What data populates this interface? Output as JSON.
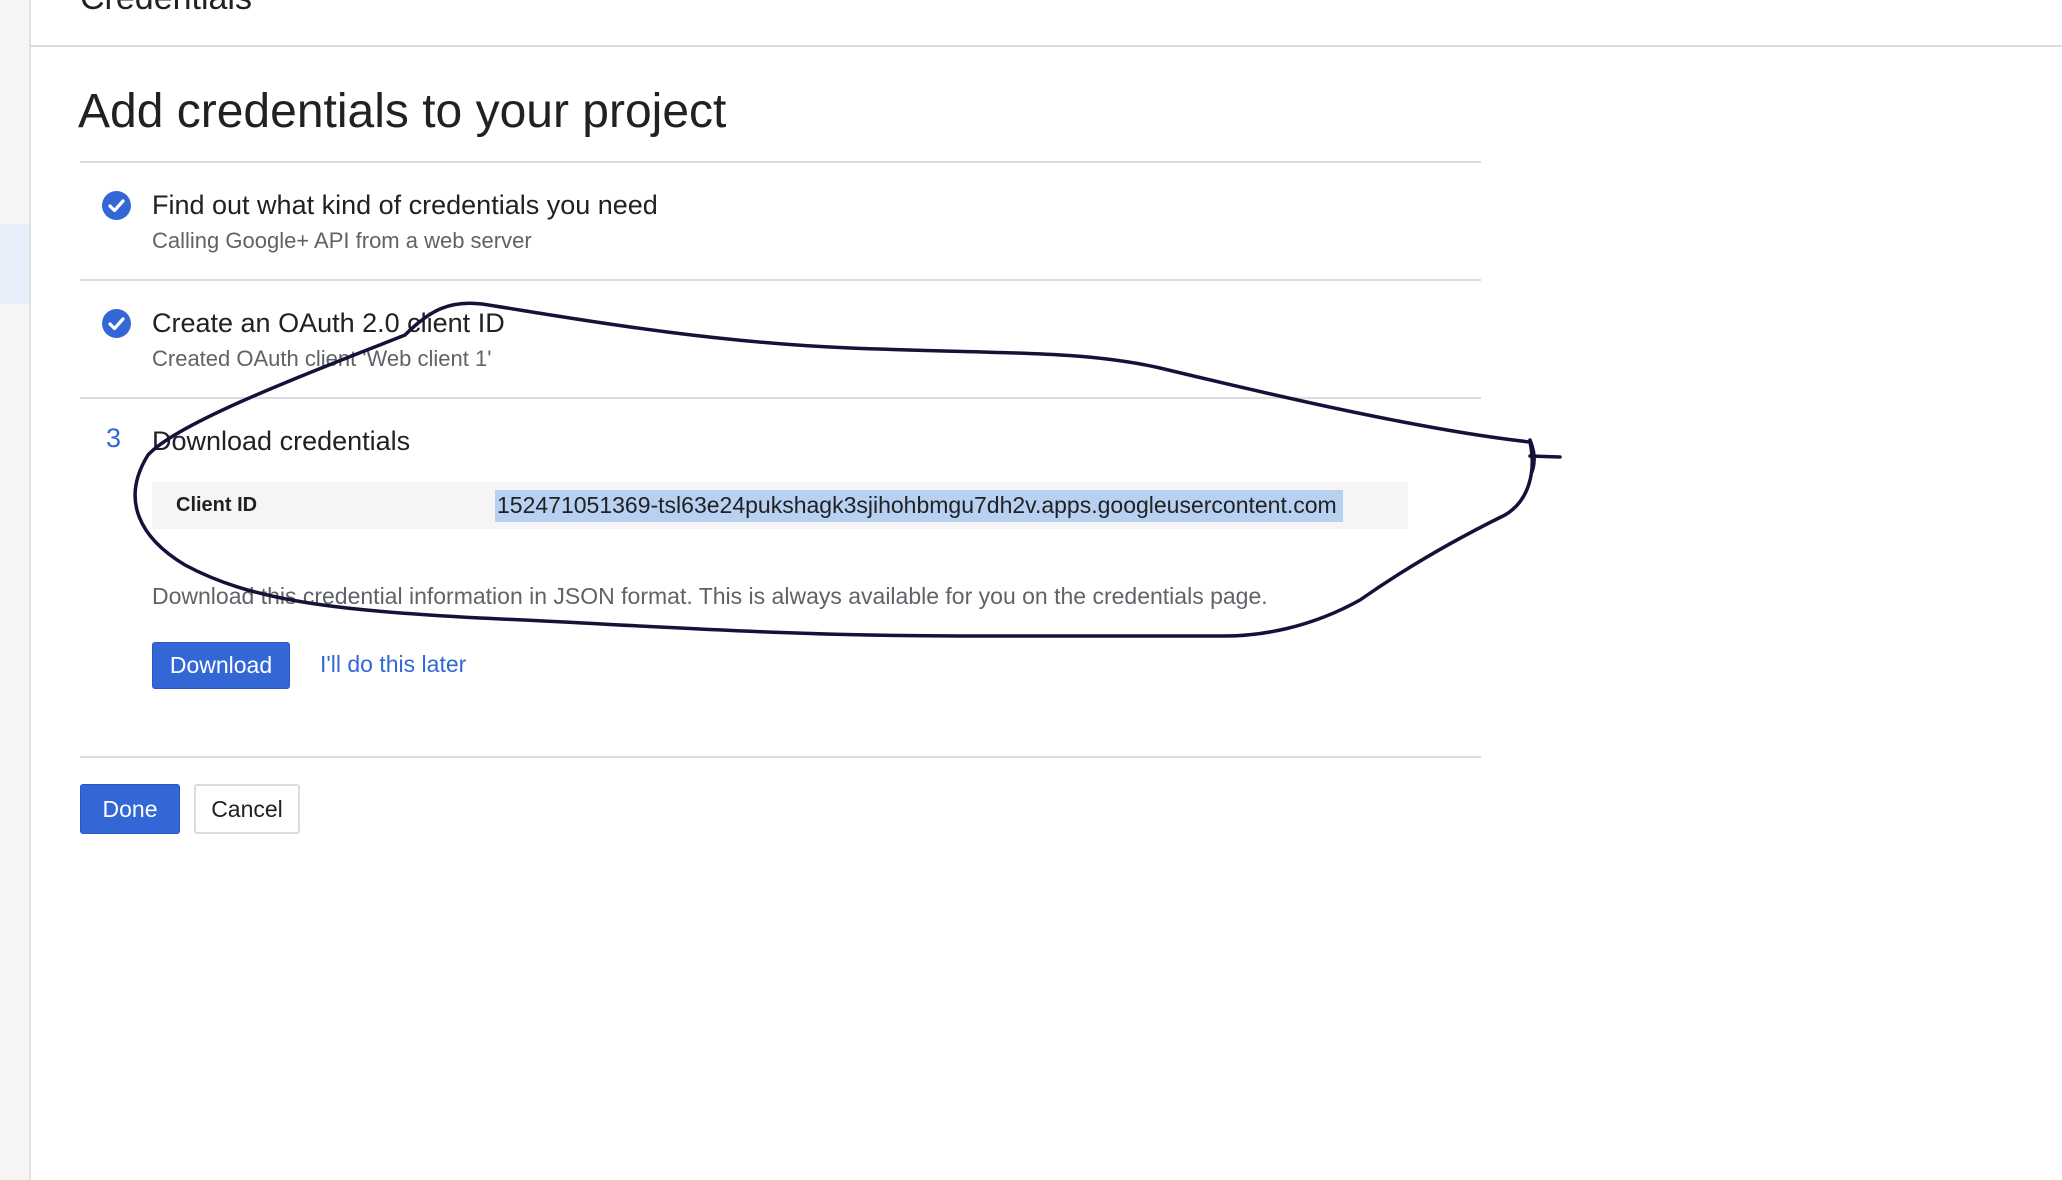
{
  "header": {
    "title": "Credentials"
  },
  "page_title": "Add credentials to your project",
  "steps": [
    {
      "status": "complete",
      "title": "Find out what kind of credentials you need",
      "subtitle": "Calling Google+ API from a web server"
    },
    {
      "status": "complete",
      "title": "Create an OAuth 2.0 client ID",
      "subtitle": "Created OAuth client 'Web client 1'"
    },
    {
      "status": "active",
      "number": "3",
      "title": "Download credentials",
      "client_id_label": "Client ID",
      "client_id_value": "152471051369-tsl63e24pukshagk3sjihohbmgu7dh2v.apps.googleusercontent.com",
      "info": "Download this credential information in JSON format. This is always available for you on the credentials page.",
      "download_label": "Download",
      "later_label": "I'll do this later"
    }
  ],
  "footer": {
    "done_label": "Done",
    "cancel_label": "Cancel"
  },
  "colors": {
    "accent": "#3367d6",
    "selection": "#b9d1f0",
    "annotation_ink": "#14123a"
  },
  "icons": {
    "step_complete": "check-circle-icon"
  }
}
